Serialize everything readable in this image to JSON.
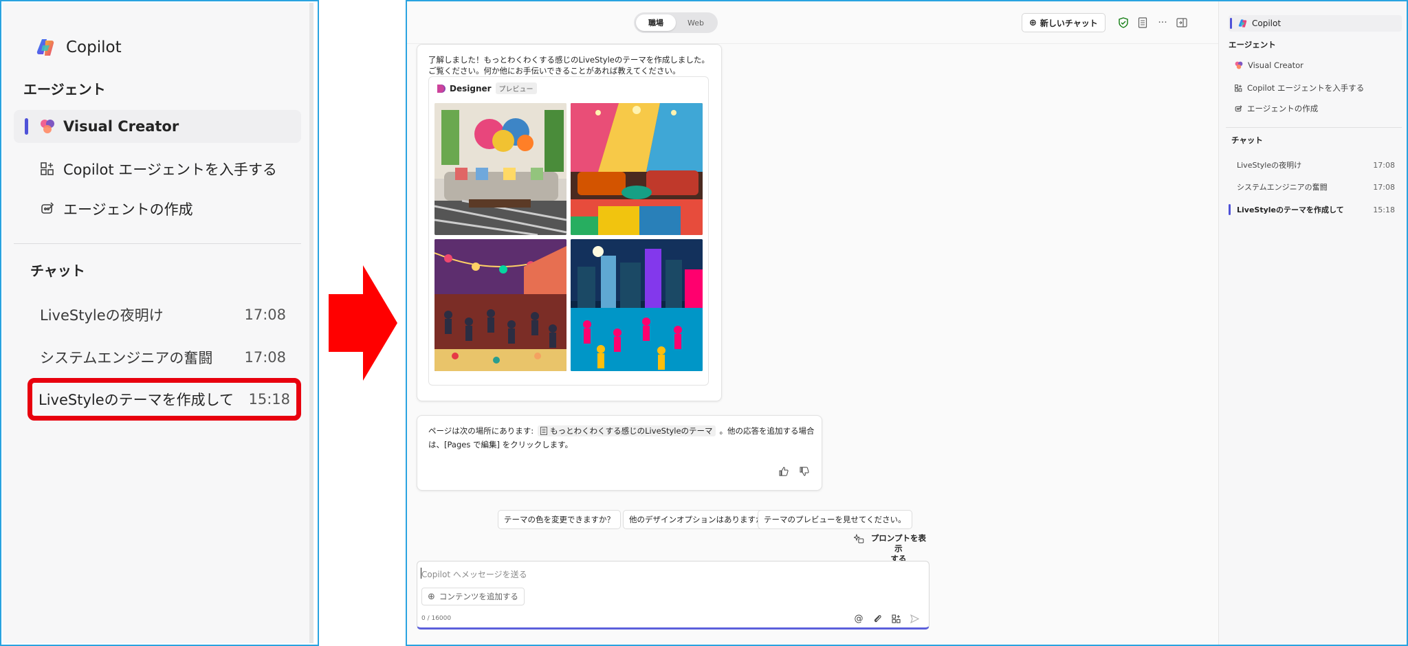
{
  "zoom_panel": {
    "brand": "Copilot",
    "agents_heading": "エージェント",
    "agents": [
      {
        "label": "Visual Creator",
        "icon": "visual-creator-icon",
        "active": true
      },
      {
        "label": "Copilot エージェントを入手する",
        "icon": "add-apps-icon",
        "active": false
      },
      {
        "label": "エージェントの作成",
        "icon": "create-agent-icon",
        "active": false
      }
    ],
    "chat_heading": "チャット",
    "chats": [
      {
        "title": "LiveStyleの夜明け",
        "time": "17:08"
      },
      {
        "title": "システムエンジニアの奮闘",
        "time": "17:08"
      },
      {
        "title": "LiveStyleのテーマを作成して",
        "time": "15:18",
        "highlighted": true
      }
    ],
    "highlight_color": "#e8000e"
  },
  "arrow": {
    "color": "#ff0000",
    "direction": "right"
  },
  "screen": {
    "toggle": {
      "work": "職場",
      "web": "Web"
    },
    "new_chat": "新しいチャット",
    "message1": {
      "text_line1": "了解しました！もっとわくわくする感じのLiveStyleのテーマを作成しました。",
      "text_line2": "ご覧ください。何か他にお手伝いできることがあれば教えてください。",
      "designer_label": "Designer",
      "preview_badge": "プレビュー"
    },
    "message2": {
      "prefix": "ページは次の場所にあります:",
      "page_link": "もっとわくわくする感じのLiveStyleのテーマ",
      "suffix": "。他の応答を追加する場合",
      "line2": "は、[Pages で編集] をクリックします。"
    },
    "suggestions": [
      "テーマの色を変更できますか？",
      "他のデザインオプションはありますか？",
      "テーマのプレビューを見せてください。"
    ],
    "show_prompts_line1": "プロンプトを表示",
    "show_prompts_line2": "する",
    "composer": {
      "placeholder": "Copilot へメッセージを送る",
      "add_content": "コンテンツを追加する",
      "char_count": "0 / 16000"
    },
    "sidebar": {
      "brand": "Copilot",
      "agents_heading": "エージェント",
      "agents": [
        {
          "label": "Visual Creator",
          "icon": "visual-creator-icon"
        },
        {
          "label": "Copilot エージェントを入手する",
          "icon": "add-apps-icon"
        },
        {
          "label": "エージェントの作成",
          "icon": "create-agent-icon"
        }
      ],
      "chat_heading": "チャット",
      "chats": [
        {
          "title": "LiveStyleの夜明け",
          "time": "17:08"
        },
        {
          "title": "システムエンジニアの奮闘",
          "time": "17:08"
        },
        {
          "title": "LiveStyleのテーマを作成して",
          "time": "15:18",
          "active": true
        }
      ]
    },
    "accent_color": "#4f52d8"
  }
}
